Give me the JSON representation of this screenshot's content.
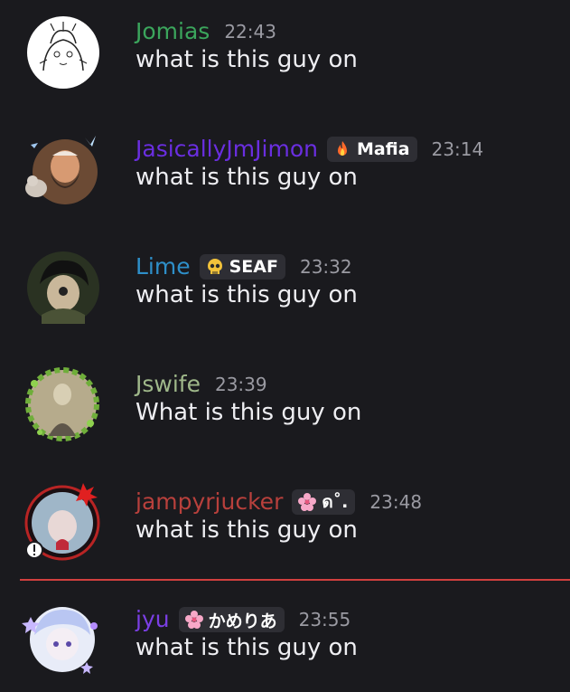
{
  "messages": [
    {
      "author": "Jomias",
      "author_color": "#3ba55c",
      "time": "22:43",
      "text": "what is this guy on",
      "avatar_icon": "sketch-character-avatar",
      "badge": null
    },
    {
      "author": "JasicallyJmJimon",
      "author_color": "#6a2ee0",
      "time": "23:14",
      "text": "what is this guy on",
      "avatar_icon": "bearded-man-with-cat-avatar",
      "badge": {
        "icon": "fire-icon",
        "label": "Mafia"
      }
    },
    {
      "author": "Lime",
      "author_color": "#2e8fc9",
      "time": "23:32",
      "text": "what is this guy on",
      "avatar_icon": "anime-character-avatar",
      "badge": {
        "icon": "skull-icon",
        "label": "SEAF"
      }
    },
    {
      "author": "Jswife",
      "author_color": "#9fb88a",
      "time": "23:39",
      "text": "What is this guy on",
      "avatar_icon": "vintage-portrait-leaf-frame-avatar",
      "badge": null
    },
    {
      "author": "jampyrjucker",
      "author_color": "#b8403c",
      "time": "23:48",
      "text": "what is this guy on",
      "avatar_icon": "anime-girl-red-frame-avatar",
      "badge": {
        "icon": "cherry-blossom-icon",
        "label": "ด˚."
      }
    },
    {
      "author": "jyu",
      "author_color": "#7b3fe4",
      "time": "23:55",
      "text": "what is this guy on",
      "avatar_icon": "anime-girl-stars-avatar",
      "badge": {
        "icon": "cherry-blossom-icon",
        "label": "かめりあ"
      }
    }
  ],
  "divider": {
    "color": "#d13f3f"
  }
}
